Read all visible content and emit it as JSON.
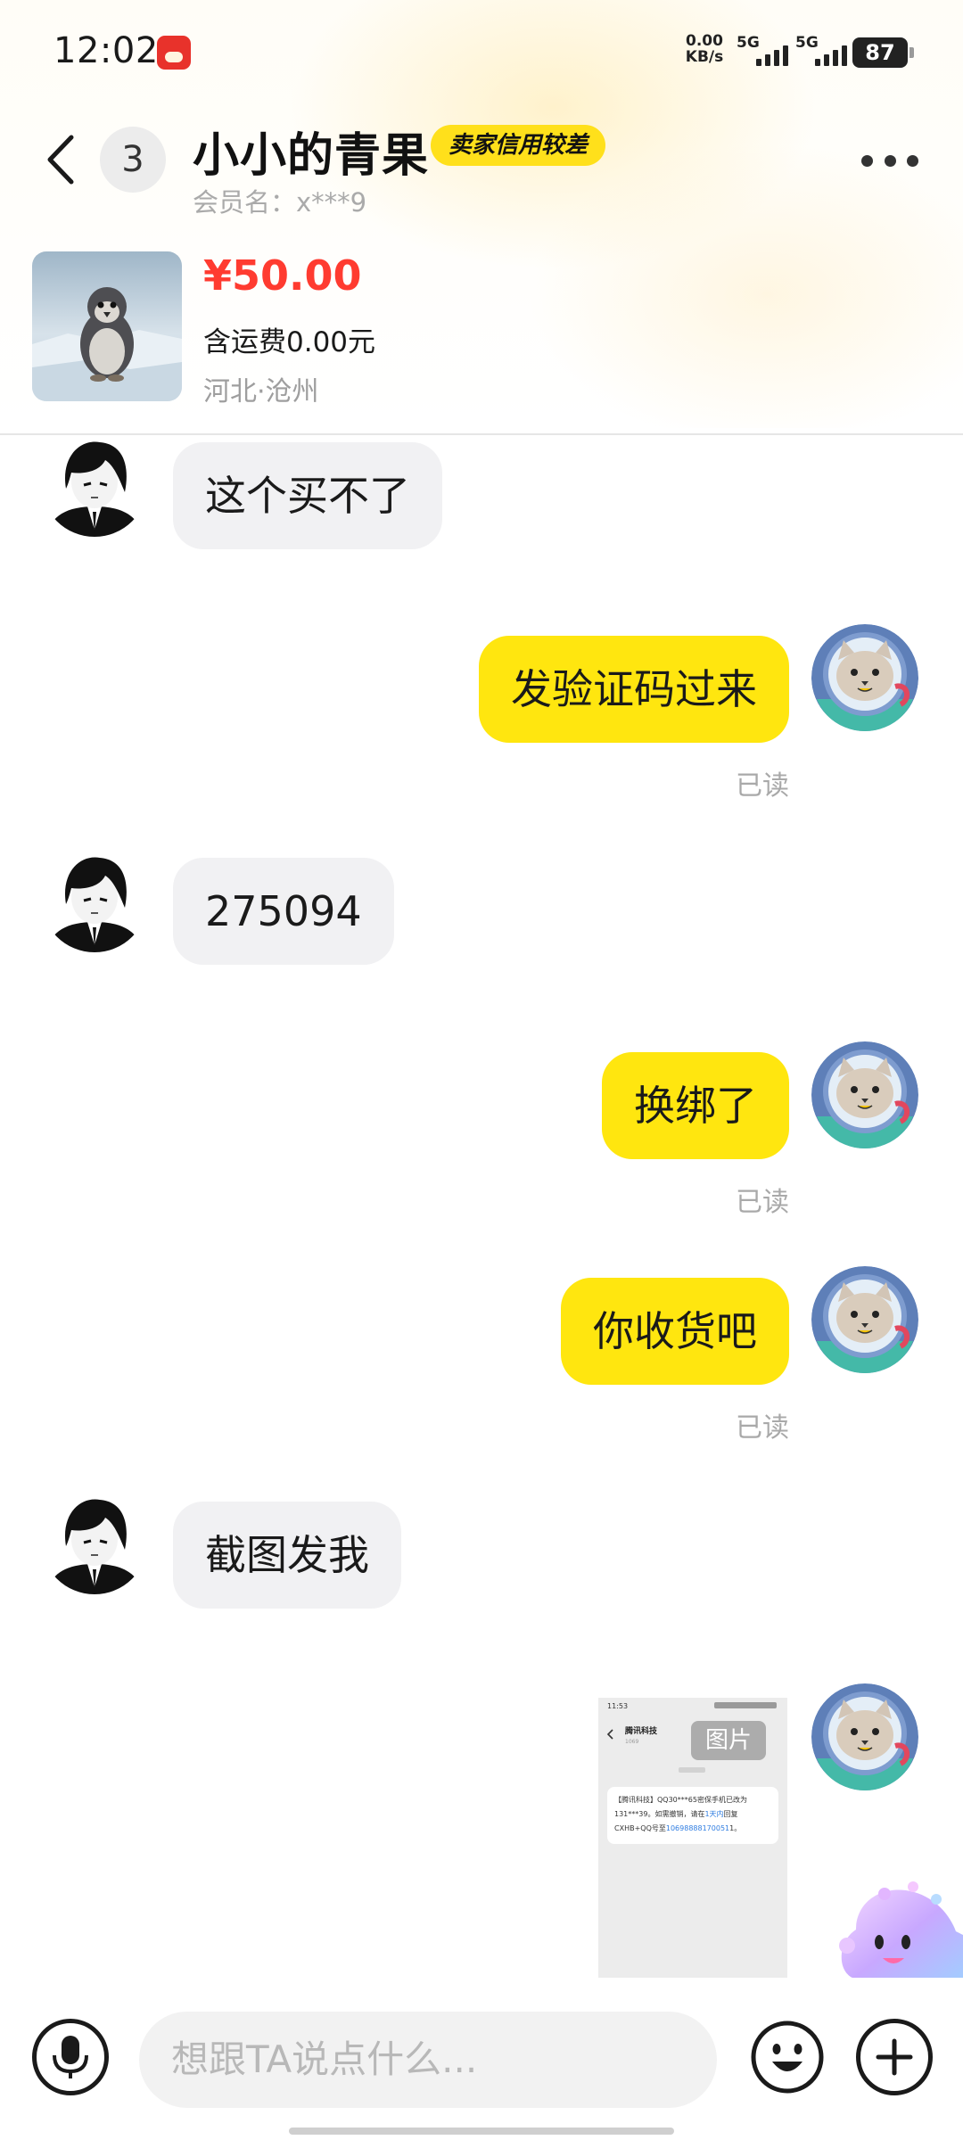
{
  "status_bar": {
    "time": "12:02",
    "net_speed_value": "0.00",
    "net_speed_unit": "KB/s",
    "sim1": "5G",
    "sim2": "5G",
    "battery": "87"
  },
  "header": {
    "unread_count": "3",
    "nickname": "小小的青果",
    "credit_badge": "卖家信用较差",
    "member_name": "会员名：x***9",
    "more_icon": "more-horizontal-icon",
    "accent_color": "#ffe01b"
  },
  "product": {
    "price": "¥50.00",
    "shipping": "含运费0.00元",
    "location": "河北·沧州",
    "price_color": "#ff3b30"
  },
  "messages": [
    {
      "side": "in",
      "text": "这个买不了"
    },
    {
      "side": "out",
      "text": "发验证码过来",
      "status": "已读"
    },
    {
      "side": "in",
      "text": "275094"
    },
    {
      "side": "out",
      "text": "换绑了",
      "status": "已读"
    },
    {
      "side": "out",
      "text": "你收货吧",
      "status": "已读"
    },
    {
      "side": "in",
      "text": "截图发我"
    },
    {
      "side": "out",
      "type": "image",
      "label": "图片",
      "screenshot": {
        "time": "11:53",
        "sender": "腾讯科技",
        "number": "1069",
        "sms_line1": "【腾讯科技】QQ30***65密保手机已改为",
        "sms_line2": "131***39。如需撤销，请在",
        "sms_highlight": "1天内",
        "sms_line2_end": "回复",
        "sms_line3": "CXHB+QQ号至",
        "sms_link": "10698888170051",
        "sms_line3_end": "1。"
      }
    }
  ],
  "input": {
    "placeholder": "想跟TA说点什么...",
    "voice_icon": "microphone-icon",
    "emoji_icon": "emoji-icon",
    "plus_icon": "plus-icon"
  },
  "colors": {
    "bubble_out": "#ffe60f",
    "bubble_in": "#f1f1f3"
  }
}
